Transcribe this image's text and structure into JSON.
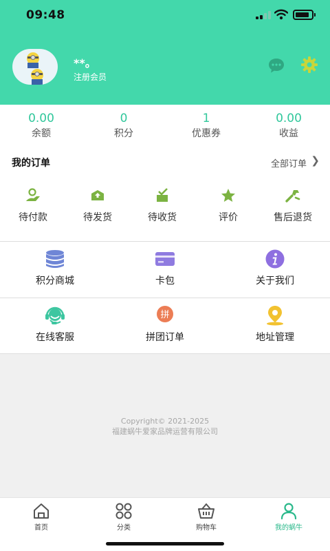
{
  "status_bar": {
    "time": "09:48"
  },
  "profile": {
    "username": "**。",
    "level": "注册会员"
  },
  "stats": [
    {
      "value": "0.00",
      "label": "余额"
    },
    {
      "value": "0",
      "label": "积分"
    },
    {
      "value": "1",
      "label": "优惠券"
    },
    {
      "value": "0.00",
      "label": "收益"
    }
  ],
  "orders": {
    "title": "我的订单",
    "all_label": "全部订单",
    "items": [
      {
        "label": "待付款",
        "icon": "payment-icon"
      },
      {
        "label": "待发货",
        "icon": "box-icon"
      },
      {
        "label": "待收货",
        "icon": "receive-icon"
      },
      {
        "label": "评价",
        "icon": "star-icon"
      },
      {
        "label": "售后退货",
        "icon": "wrench-icon"
      }
    ]
  },
  "services": [
    {
      "label": "积分商城",
      "icon": "database-icon",
      "color": "#6f86d6"
    },
    {
      "label": "卡包",
      "icon": "card-icon",
      "color": "#8f7be0"
    },
    {
      "label": "关于我们",
      "icon": "info-icon",
      "color": "#8e6fe0"
    },
    {
      "label": "在线客服",
      "icon": "headset-icon",
      "color": "#3dc6a0"
    },
    {
      "label": "拼团订单",
      "icon": "group-order-icon",
      "icon_text": "拼",
      "color": "#ec7d55"
    },
    {
      "label": "地址管理",
      "icon": "location-icon",
      "color": "#f2c230"
    }
  ],
  "copyright": {
    "line1": "Copyright© 2021-2025",
    "line2": "福建蜗牛爱家品牌运营有限公司"
  },
  "tabbar": [
    {
      "label": "首页",
      "icon": "home-icon"
    },
    {
      "label": "分类",
      "icon": "grid-icon"
    },
    {
      "label": "购物车",
      "icon": "basket-icon"
    },
    {
      "label": "我的蜗牛",
      "icon": "user-icon",
      "active": true
    }
  ],
  "colors": {
    "header": "#43d8ab",
    "accent": "#30c79b",
    "order_icons": "#7cb342"
  }
}
